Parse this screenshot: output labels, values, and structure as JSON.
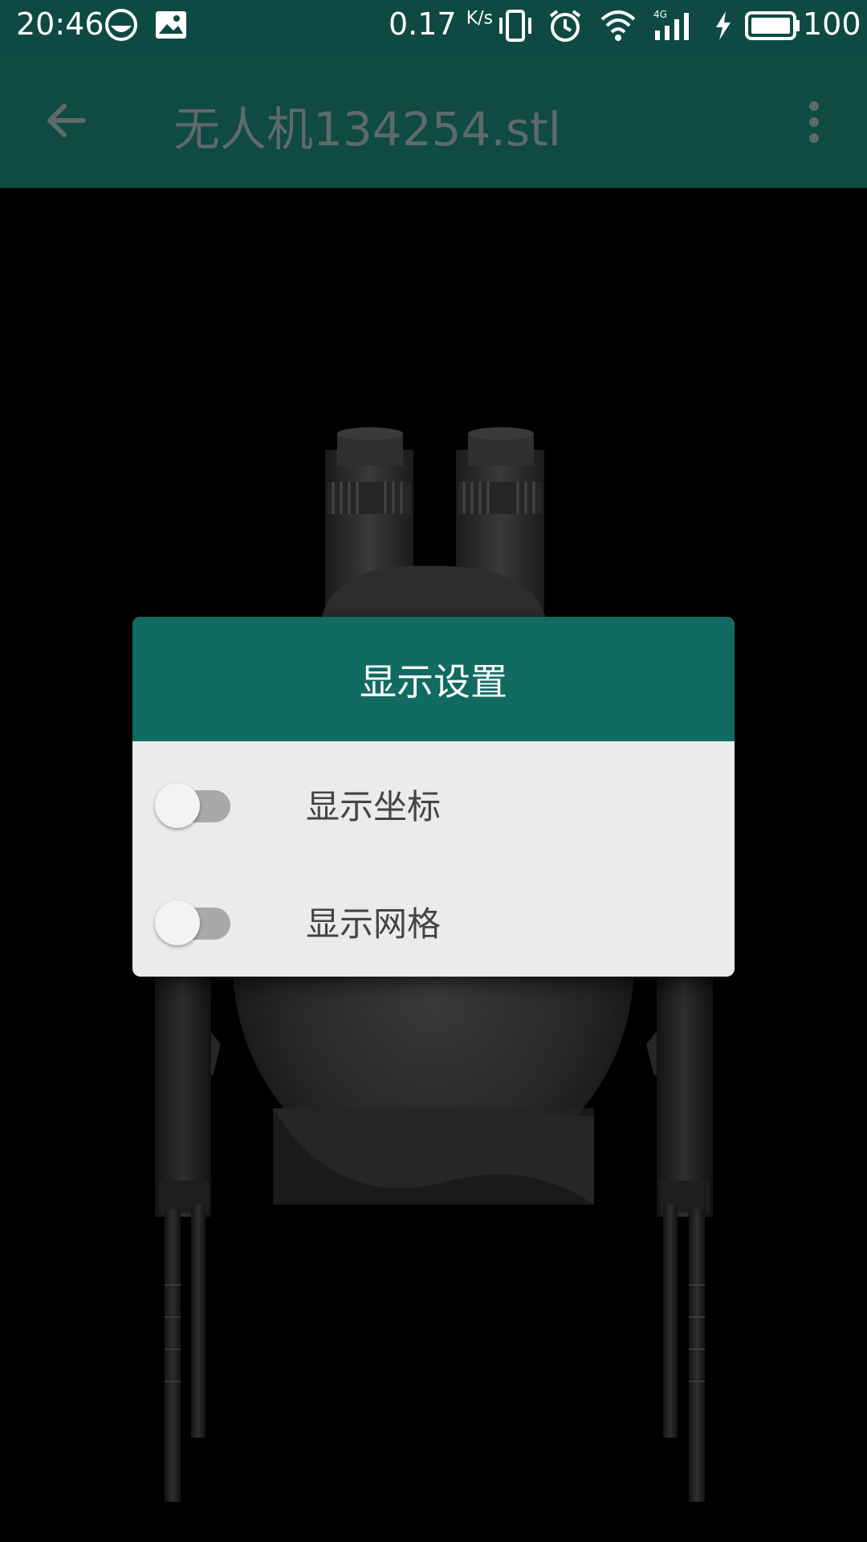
{
  "status_bar": {
    "time": "20:46",
    "net_speed": "0.17",
    "net_unit": "K/s",
    "battery_level": "100",
    "icons": [
      "face-icon",
      "image-icon",
      "vibrate-icon",
      "alarm-icon",
      "wifi-icon",
      "signal-4g-icon",
      "charging-icon",
      "battery-icon"
    ]
  },
  "app_bar": {
    "title": "无人机134254.stl",
    "back_icon": "arrow-back-icon",
    "menu_icon": "more-vert-icon"
  },
  "dialog": {
    "title": "显示设置",
    "options": [
      {
        "label": "显示坐标",
        "checked": false
      },
      {
        "label": "显示网格",
        "checked": false
      }
    ]
  },
  "colors": {
    "status_bar": "#0e4a43",
    "app_bar_dimmed": "#0f4a43",
    "dialog_header": "#116b62",
    "dialog_body": "#ebebeb",
    "switch_track_off": "#a9a9a9"
  }
}
